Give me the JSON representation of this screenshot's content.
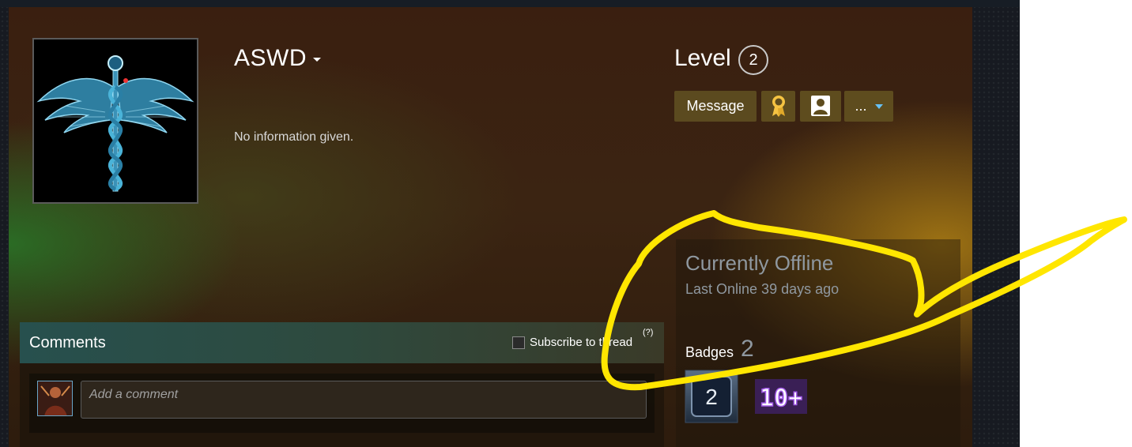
{
  "profile": {
    "persona_name": "ASWD",
    "summary": "No information given.",
    "level_label": "Level",
    "level_value": "2"
  },
  "actions": {
    "message_label": "Message",
    "more_label": "...",
    "award_icon": "award-ribbon-icon",
    "avatar_icon": "user-portrait-icon"
  },
  "status": {
    "title": "Currently Offline",
    "last_online": "Last Online 39 days ago"
  },
  "badges": {
    "label": "Badges",
    "count": "2",
    "items": [
      {
        "text": "2"
      },
      {
        "text": "10+"
      }
    ]
  },
  "comments": {
    "title": "Comments",
    "subscribe_label": "Subscribe to thread",
    "help_label": "(?)",
    "input_placeholder": "Add a comment"
  },
  "colors": {
    "annotation": "#ffe600",
    "button_bg": "#5b4a1f",
    "award_icon": "#f5c342",
    "caret": "#67c1f5"
  }
}
